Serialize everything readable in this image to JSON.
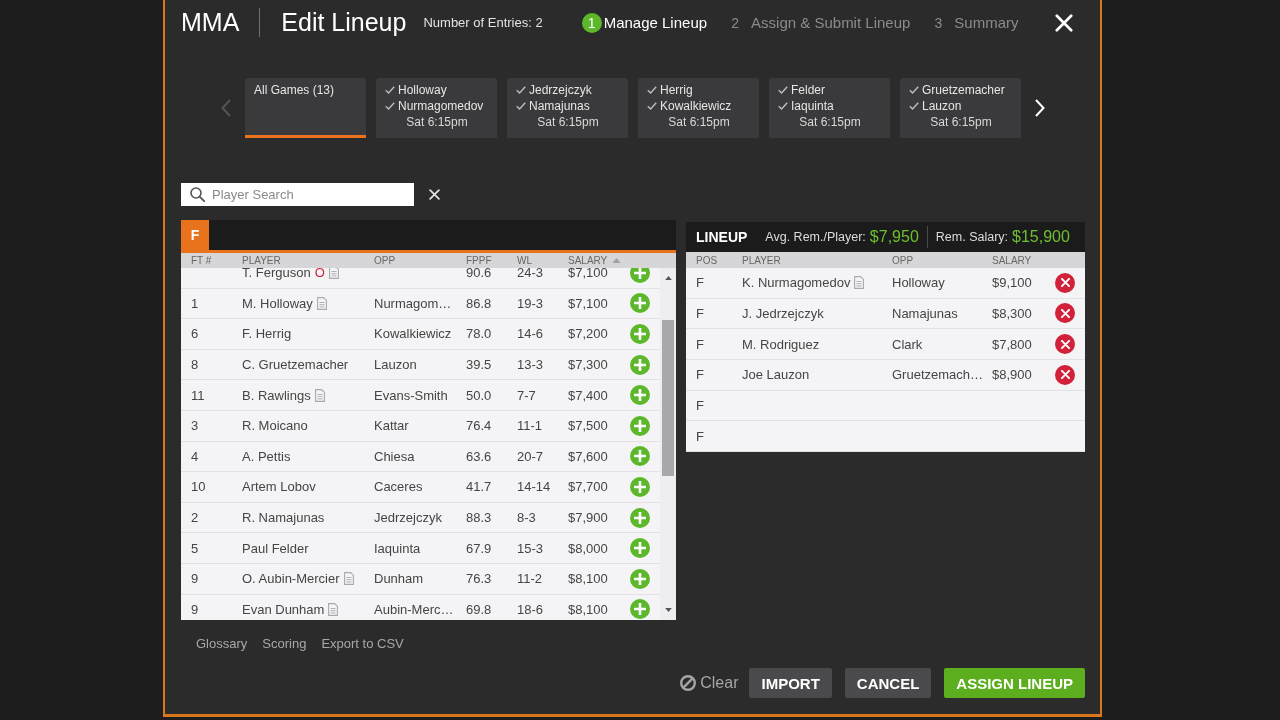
{
  "header": {
    "sport": "MMA",
    "title": "Edit Lineup",
    "entries": "Number of Entries: 2",
    "steps": [
      {
        "number": "1",
        "label": "Manage Lineup",
        "selected": true
      },
      {
        "number": "2",
        "label": "Assign & Submit Lineup",
        "selected": false
      },
      {
        "number": "3",
        "label": "Summary",
        "selected": false
      }
    ]
  },
  "games": {
    "previous": {
      "disabled": true
    },
    "next": {
      "disabled": false
    },
    "tiles": [
      {
        "kind": "all",
        "label": "All Games (13)",
        "selected": true
      },
      {
        "kind": "game",
        "fighters": [
          {
            "name": "Holloway",
            "checked": true
          },
          {
            "name": "Nurmagomedov",
            "checked": true
          }
        ],
        "time": "Sat 6:15pm",
        "selected": false
      },
      {
        "kind": "game",
        "fighters": [
          {
            "name": "Jedrzejczyk",
            "checked": true
          },
          {
            "name": "Namajunas",
            "checked": true
          }
        ],
        "time": "Sat 6:15pm",
        "selected": false
      },
      {
        "kind": "game",
        "fighters": [
          {
            "name": "Herrig",
            "checked": true
          },
          {
            "name": "Kowalkiewicz",
            "checked": true
          }
        ],
        "time": "Sat 6:15pm",
        "selected": false
      },
      {
        "kind": "game",
        "fighters": [
          {
            "name": "Felder",
            "checked": true
          },
          {
            "name": "Iaquinta",
            "checked": true
          }
        ],
        "time": "Sat 6:15pm",
        "selected": false
      },
      {
        "kind": "game",
        "fighters": [
          {
            "name": "Gruetzemacher",
            "checked": true
          },
          {
            "name": "Lauzon",
            "checked": true
          }
        ],
        "time": "Sat 6:15pm",
        "selected": false
      }
    ]
  },
  "search": {
    "placeholder": "Player Search"
  },
  "player_pool": {
    "positions": [
      {
        "label": "F",
        "selected": true
      }
    ],
    "columns": [
      {
        "label": "FT #",
        "sorted": false
      },
      {
        "label": "PLAYER",
        "sorted": false
      },
      {
        "label": "OPP",
        "sorted": false
      },
      {
        "label": "FPPF",
        "sorted": false
      },
      {
        "label": "WL",
        "sorted": false
      },
      {
        "label": "SALARY",
        "sorted": true
      }
    ],
    "rows": [
      {
        "player": "T. Ferguson",
        "status": "O",
        "notes": true,
        "fppf": "90.6",
        "wl": "24-3",
        "salary": "$7,100"
      },
      {
        "ft": "1",
        "player": "M. Holloway",
        "notes": true,
        "opp": "Nurmagom…",
        "fppf": "86.8",
        "wl": "19-3",
        "salary": "$7,100"
      },
      {
        "ft": "6",
        "player": "F. Herrig",
        "notes": false,
        "opp": "Kowalkiewicz",
        "fppf": "78.0",
        "wl": "14-6",
        "salary": "$7,200"
      },
      {
        "ft": "8",
        "player": "C. Gruetzemacher",
        "notes": false,
        "opp": "Lauzon",
        "fppf": "39.5",
        "wl": "13-3",
        "salary": "$7,300"
      },
      {
        "ft": "11",
        "player": "B. Rawlings",
        "notes": true,
        "opp": "Evans-Smith",
        "fppf": "50.0",
        "wl": "7-7",
        "salary": "$7,400"
      },
      {
        "ft": "3",
        "player": "R. Moicano",
        "notes": false,
        "opp": "Kattar",
        "fppf": "76.4",
        "wl": "11-1",
        "salary": "$7,500"
      },
      {
        "ft": "4",
        "player": "A. Pettis",
        "notes": false,
        "opp": "Chiesa",
        "fppf": "63.6",
        "wl": "20-7",
        "salary": "$7,600"
      },
      {
        "ft": "10",
        "player": "Artem Lobov",
        "notes": false,
        "opp": "Caceres",
        "fppf": "41.7",
        "wl": "14-14",
        "salary": "$7,700"
      },
      {
        "ft": "2",
        "player": "R. Namajunas",
        "notes": false,
        "opp": "Jedrzejczyk",
        "fppf": "88.3",
        "wl": "8-3",
        "salary": "$7,900"
      },
      {
        "ft": "5",
        "player": "Paul Felder",
        "notes": false,
        "opp": "Iaquinta",
        "fppf": "67.9",
        "wl": "15-3",
        "salary": "$8,000"
      },
      {
        "ft": "9",
        "player": "O. Aubin-Mercier",
        "notes": true,
        "opp": "Dunham",
        "fppf": "76.3",
        "wl": "11-2",
        "salary": "$8,100"
      },
      {
        "ft": "9",
        "player": "Evan Dunham",
        "notes": true,
        "opp": "Aubin-Merc…",
        "fppf": "69.8",
        "wl": "18-6",
        "salary": "$8,100"
      }
    ]
  },
  "lineup": {
    "title": "LINEUP",
    "avg_label": "Avg. Rem./Player:",
    "avg_value": "$7,950",
    "rem_label": "Rem. Salary:",
    "rem_value": "$15,900",
    "columns": [
      "POS",
      "PLAYER",
      "OPP",
      "SALARY"
    ],
    "rows": [
      {
        "pos": "F",
        "player": "K. Nurmagomedov",
        "notes": true,
        "opp": "Holloway",
        "salary": "$9,100"
      },
      {
        "pos": "F",
        "player": "J. Jedrzejczyk",
        "notes": false,
        "opp": "Namajunas",
        "salary": "$8,300"
      },
      {
        "pos": "F",
        "player": "M. Rodriguez",
        "notes": false,
        "opp": "Clark",
        "salary": "$7,800"
      },
      {
        "pos": "F",
        "player": "Joe Lauzon",
        "notes": false,
        "opp": "Gruetzemach…",
        "salary": "$8,900"
      },
      {
        "pos": "F",
        "notes": false
      },
      {
        "pos": "F",
        "notes": false
      }
    ]
  },
  "links": [
    "Glossary",
    "Scoring",
    "Export to CSV"
  ],
  "actions": {
    "clear": "Clear",
    "buttons": [
      {
        "label": "IMPORT",
        "kind": "secondary"
      },
      {
        "label": "CANCEL",
        "kind": "secondary"
      },
      {
        "label": "ASSIGN LINEUP",
        "kind": "primary"
      }
    ]
  }
}
